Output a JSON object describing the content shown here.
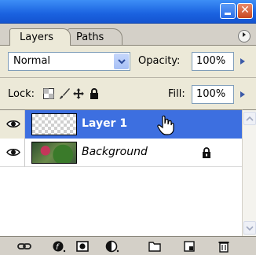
{
  "window": {
    "minimize_glyph": "",
    "close_glyph": "✕"
  },
  "tabs": [
    {
      "label": "Layers",
      "active": true
    },
    {
      "label": "Paths",
      "active": false
    }
  ],
  "options": {
    "blend_mode": "Normal",
    "opacity_label": "Opacity:",
    "opacity_value": "100%",
    "lock_label": "Lock:",
    "fill_label": "Fill:",
    "fill_value": "100%"
  },
  "layers": [
    {
      "name": "Layer 1",
      "selected": true,
      "visible": true,
      "locked": false,
      "thumbnail": "transparent-checker"
    },
    {
      "name": "Background",
      "selected": false,
      "visible": true,
      "locked": true,
      "thumbnail": "photo"
    }
  ],
  "bottom_icons": [
    "link-icon",
    "layer-style-icon",
    "mask-icon",
    "adjustment-icon",
    "folder-icon",
    "new-layer-icon",
    "trash-icon"
  ],
  "colors": {
    "title_bar": "#1a62e0",
    "selected_row": "#3d6fe0",
    "panel_bg": "#ece9d8"
  }
}
